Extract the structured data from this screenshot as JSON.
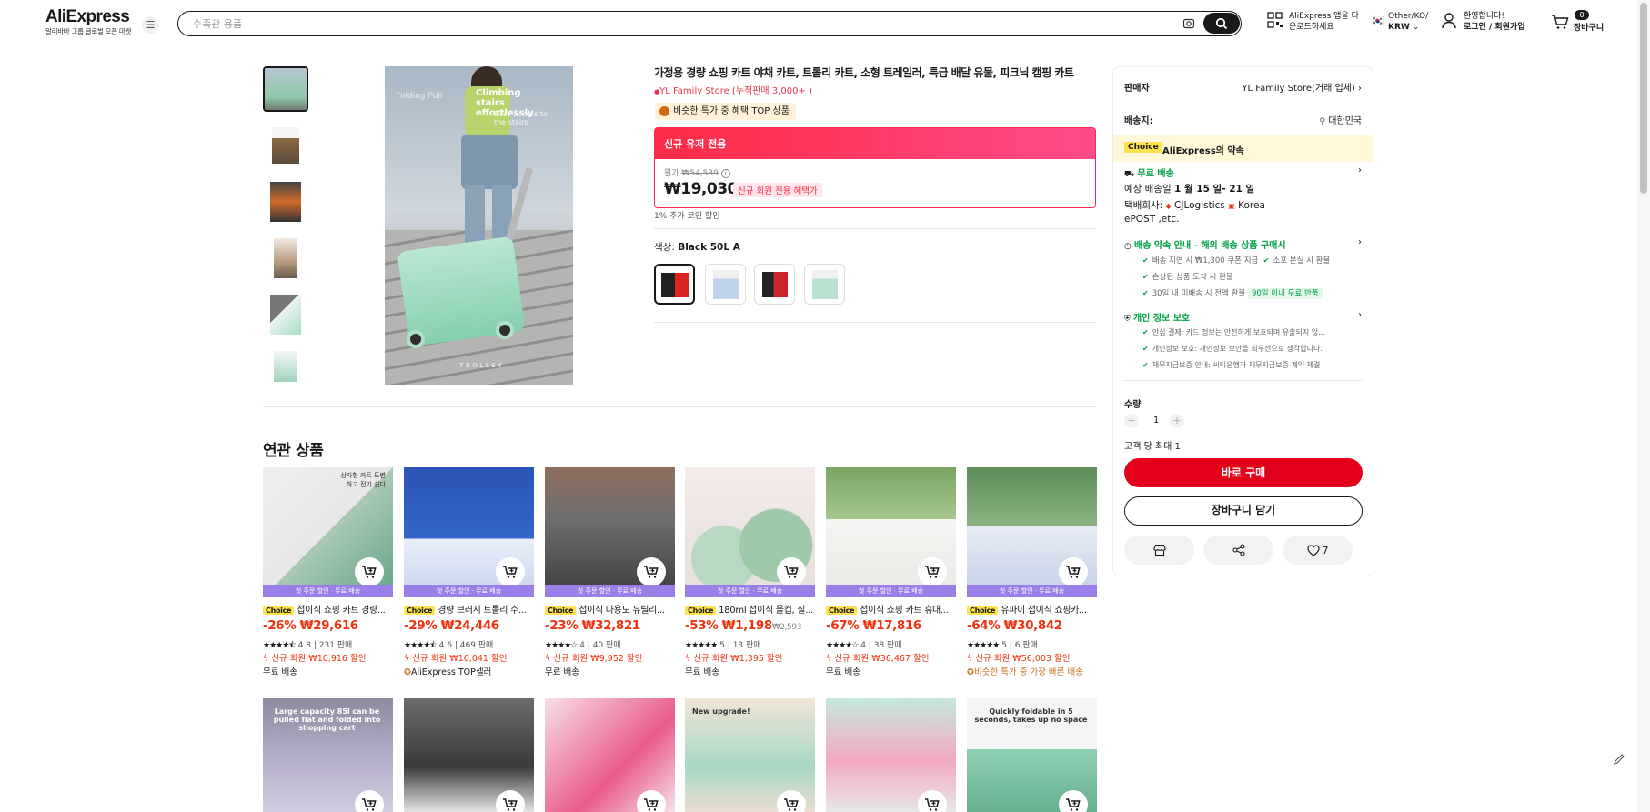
{
  "header": {
    "logo": "AliExpress",
    "logo_sub": "알리바바 그룹 글로벌 오픈 마켓",
    "search_placeholder": "수족관 용품",
    "app_line1": "AliExpress 앱을 다",
    "app_line2": "운로드하세요",
    "region_line1": "Other/KO/",
    "region_line2": "KRW",
    "account_line1": "환영합니다!",
    "account_line2": "로그인 / 회원가입",
    "cart_count": "0",
    "cart_label": "장바구니"
  },
  "product": {
    "title": "가정용 경량 쇼핑 카트 야채 카트, 트롤리 카트, 소형 트레일러, 특급 배달 유물, 피크닉 캠핑 카트",
    "store": "YL Family Store (누적판매 3,000+ )",
    "deal_tag": "비슷한 특가 중 혜택 TOP 상품",
    "banner": "신규 유저 전용",
    "orig_label": "원가",
    "orig_price": "₩54,539",
    "price": "₩19,030",
    "new_user_tag": "신규 회원 전용 혜택가",
    "coin_note": "1% 추가 코인 할인",
    "color_label": "색상:",
    "color_value": "Black 50L A",
    "image_text1": "Folding Pull",
    "image_text2": "Climbing stairs effortlessly",
    "image_text3": "Easy access to the stairs",
    "image_brand": "TROLLEY"
  },
  "right_panel": {
    "seller_label": "판매자",
    "seller_value": "YL Family Store(거래 업체)",
    "ship_to_label": "배송지:",
    "ship_to_value": "대한민국",
    "choice": "Choice",
    "promise": "AliExpress의 약속",
    "free_ship": "무료 배송",
    "eta_prefix": "예상 배송일",
    "eta": "1 월 15 일- 21 일",
    "courier_prefix": "택배회사:",
    "courier_1": "CJLogistics",
    "courier_2": "Korea",
    "courier_3": "ePOST ,etc.",
    "guarantee_title": "배송 약속 안내 - 해외 배송 상품 구매시",
    "g1": "배송 지연 시 ₩1,300 쿠폰 지급",
    "g2": "소포 분실 시 환불",
    "g3": "손상된 상품 도착 시 환불",
    "g4": "30일 내 미배송 시 전액 환불",
    "g4_tag": "90일 이내 무료 반품",
    "privacy_title": "개인 정보 보호",
    "p1": "안심 결제: 카드 정보는 안전하게 보호되며 유출되지 않...",
    "p2": "개인정보 보호: 개인정보 보안을 최우선으로 생각합니다.",
    "p3": "채무지급보증 안내: 씨티은행과 채무지급보증 계약 체결",
    "qty_label": "수량",
    "qty_minus": "−",
    "qty_value": "1",
    "qty_plus": "+",
    "qty_max": "고객 당 최대 1",
    "buy_now": "바로 구매",
    "add_cart": "장바구니 담기",
    "wish_count": "7"
  },
  "related": {
    "title": "연관 상품",
    "strip": "첫 주문 할인 · 무료 배송",
    "choice": "Choice",
    "items": [
      {
        "title": "접이식 쇼핑 카트 경량...",
        "price": "-26% ₩29,616",
        "old": "",
        "stars": "★★★★⯪",
        "rating": "4.8 | 231 판매",
        "new": "신규 회원 ₩10,916 할인",
        "ship": "무료 배송",
        "img_text": "상자형 카트 도변하고 접기 쉽다"
      },
      {
        "title": "경량 브러시 트롤리 수...",
        "price": "-29% ₩24,446",
        "old": "",
        "stars": "★★★★⯪",
        "rating": "4.6 | 469 판매",
        "new": "신규 회원 ₩10,041 할인",
        "ship": "AliExpress TOP셀러",
        "img_text": ""
      },
      {
        "title": "접이식 다용도 유틸리...",
        "price": "-23% ₩32,821",
        "old": "",
        "stars": "★★★★☆",
        "rating": "4 | 40 판매",
        "new": "신규 회원 ₩9,952 할인",
        "ship": "무료 배송",
        "img_text": ""
      },
      {
        "title": "180ml 접이식 물컵, 실...",
        "price": "-53% ₩1,198",
        "old": "₩2,593",
        "stars": "★★★★★",
        "rating": "5 | 13 판매",
        "new": "신규 회원 ₩1,395 할인",
        "ship": "무료 배송",
        "img_text": ""
      },
      {
        "title": "접이식 쇼핑 카트 휴대...",
        "price": "-67% ₩17,816",
        "old": "",
        "stars": "★★★★☆",
        "rating": "4 | 38 판매",
        "new": "신규 회원 ₩36,467 할인",
        "ship": "무료 배송",
        "img_text": ""
      },
      {
        "title": "유파이 접이식 쇼핑카...",
        "price": "-64% ₩30,842",
        "old": "",
        "stars": "★★★★★",
        "rating": "5 | 6 판매",
        "new": "신규 회원 ₩56,003 할인",
        "ship": "비슷한 특가 중 가장 빠른 배송",
        "img_text": ""
      }
    ],
    "row2_text": [
      "Large capacity 85l can be pulled flat and folded into shopping cart",
      "",
      "",
      "New upgrade!",
      "",
      "Quickly foldable in 5 seconds, takes up no space"
    ]
  },
  "colors": {
    "accent_red": "#e31a2b",
    "choice_yellow": "#ffe14d",
    "green": "#00a046",
    "strip_purple": "#9b7fe8"
  }
}
